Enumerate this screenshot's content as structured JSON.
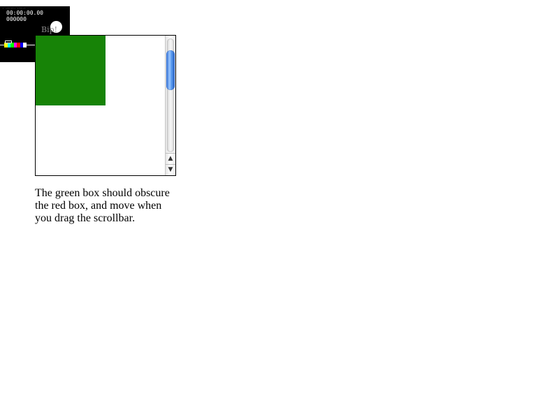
{
  "video": {
    "tiny_header": "· ······ ·····",
    "timecode": "00:00:00.00",
    "frame": "000000",
    "bip_text": "Bip!",
    "color_bars": [
      "#ffff00",
      "#00ffff",
      "#00ff00",
      "#ff00ff",
      "#ff0000",
      "#0000ff",
      "#ffffff"
    ]
  },
  "scrollbox": {
    "red_box_color": "#ff0000",
    "green_box_color": "#178307",
    "scroll_up_icon": "▲",
    "scroll_down_icon": "▼"
  },
  "caption": {
    "text": "The green box should obscure the red box, and move when you drag the scrollbar."
  }
}
